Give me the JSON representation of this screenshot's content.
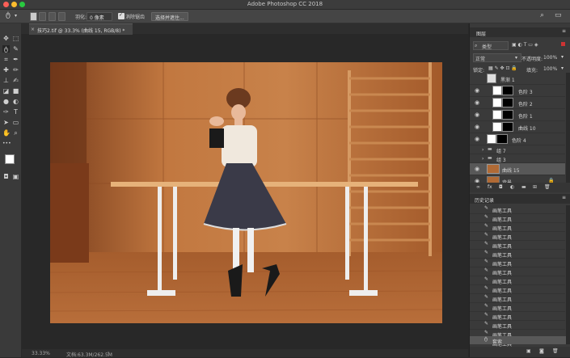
{
  "window": {
    "title": "Adobe Photoshop CC 2018"
  },
  "colors": {
    "close": "#fc5f57",
    "minimize": "#fdbc2e",
    "maximize": "#29c940"
  },
  "options": {
    "feather_label": "羽化:",
    "feather_value": "0 像素",
    "antialias_label": "消除锯齿",
    "select_mask_button": "选择并遮住..."
  },
  "document_tab": {
    "title": "技巧2.tif @ 33.3% (曲线 15, RGB/8) *"
  },
  "statusbar": {
    "zoom": "33.33%",
    "doc_info": "文档:63.3M/262.5M"
  },
  "layers_panel": {
    "tab": "图层",
    "kind_filter": "类型",
    "blend_mode": "正常",
    "opacity_label": "不透明度:",
    "opacity_value": "100%",
    "lock_label": "锁定:",
    "fill_label": "填充:",
    "fill_value": "100%",
    "layers": [
      {
        "name": "黑渐 1",
        "visible": false
      },
      {
        "name": "色阶 3",
        "visible": true
      },
      {
        "name": "色阶 2",
        "visible": true
      },
      {
        "name": "色阶 1",
        "visible": true
      },
      {
        "name": "曲线 10",
        "visible": true
      },
      {
        "name": "色阶 4",
        "visible": true
      },
      {
        "name": "组 7",
        "visible": false
      },
      {
        "name": "组 3",
        "visible": false
      },
      {
        "name": "曲线 15",
        "visible": true
      },
      {
        "name": "背景",
        "visible": true
      }
    ]
  },
  "history_panel": {
    "tab": "历史记录",
    "items": [
      "画笔工具",
      "画笔工具",
      "画笔工具",
      "画笔工具",
      "画笔工具",
      "画笔工具",
      "画笔工具",
      "画笔工具",
      "画笔工具",
      "画笔工具",
      "画笔工具",
      "画笔工具",
      "画笔工具",
      "画笔工具",
      "画笔工具",
      "画笔工具"
    ],
    "last_item": "套索"
  }
}
